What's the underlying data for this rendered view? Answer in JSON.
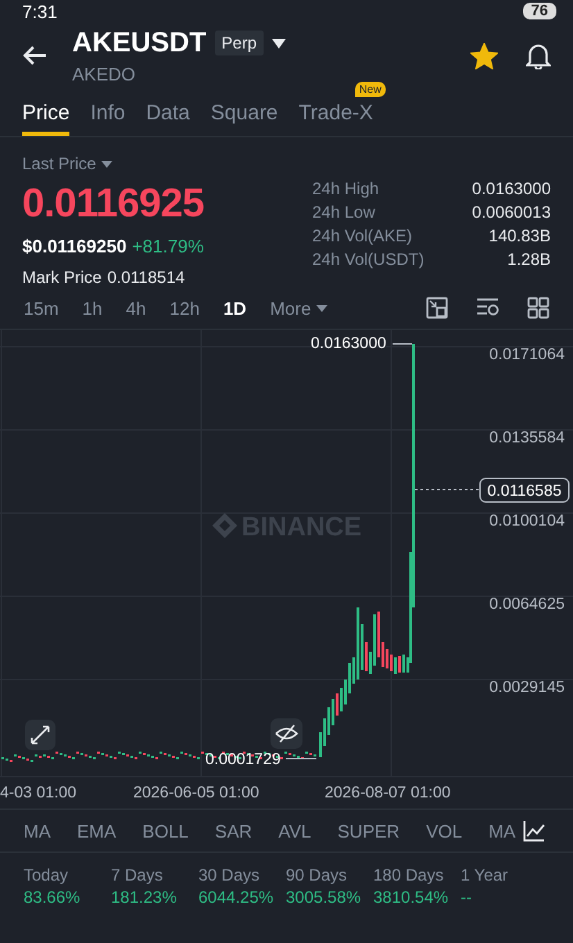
{
  "status_bar": {
    "time": "7:31",
    "battery": "76"
  },
  "header": {
    "symbol": "AKEUSDT",
    "contract_type": "Perp",
    "name": "AKEDO",
    "favorite": true
  },
  "tabs": [
    {
      "label": "Price",
      "selected": true
    },
    {
      "label": "Info",
      "selected": false
    },
    {
      "label": "Data",
      "selected": false
    },
    {
      "label": "Square",
      "selected": false
    },
    {
      "label": "Trade-X",
      "selected": false,
      "badge": "New"
    }
  ],
  "price": {
    "label": "Last Price",
    "last": "0.0116925",
    "usd": "$0.01169250",
    "change": "+81.79%",
    "mark_label": "Mark Price",
    "mark": "0.0118514"
  },
  "stats": [
    {
      "label": "24h High",
      "value": "0.0163000"
    },
    {
      "label": "24h Low",
      "value": "0.0060013"
    },
    {
      "label": "24h Vol(AKE)",
      "value": "140.83B"
    },
    {
      "label": "24h Vol(USDT)",
      "value": "1.28B"
    }
  ],
  "timeframes": [
    {
      "label": "15m",
      "selected": false
    },
    {
      "label": "1h",
      "selected": false
    },
    {
      "label": "4h",
      "selected": false
    },
    {
      "label": "12h",
      "selected": false
    },
    {
      "label": "1D",
      "selected": true
    },
    {
      "label": "More",
      "selected": false
    }
  ],
  "chart": {
    "watermark": "BINANCE",
    "y_labels": [
      "0.0171064",
      "0.0135584",
      "0.0100104",
      "0.0064625",
      "0.0029145"
    ],
    "x_labels": [
      "4-03 01:00",
      "2026-06-05 01:00",
      "2026-08-07 01:00"
    ],
    "high_marker": "0.0163000",
    "low_marker": "0.0001729",
    "current_price": "0.0116585"
  },
  "indicators": [
    "MA",
    "EMA",
    "BOLL",
    "SAR",
    "AVL",
    "SUPER",
    "VOL",
    "MA"
  ],
  "performance": [
    {
      "period": "Today",
      "value": "83.66%"
    },
    {
      "period": "7 Days",
      "value": "181.23%"
    },
    {
      "period": "30 Days",
      "value": "6044.25%"
    },
    {
      "period": "90 Days",
      "value": "3005.58%"
    },
    {
      "period": "180 Days",
      "value": "3810.54%"
    },
    {
      "period": "1 Year",
      "value": "--"
    }
  ]
}
